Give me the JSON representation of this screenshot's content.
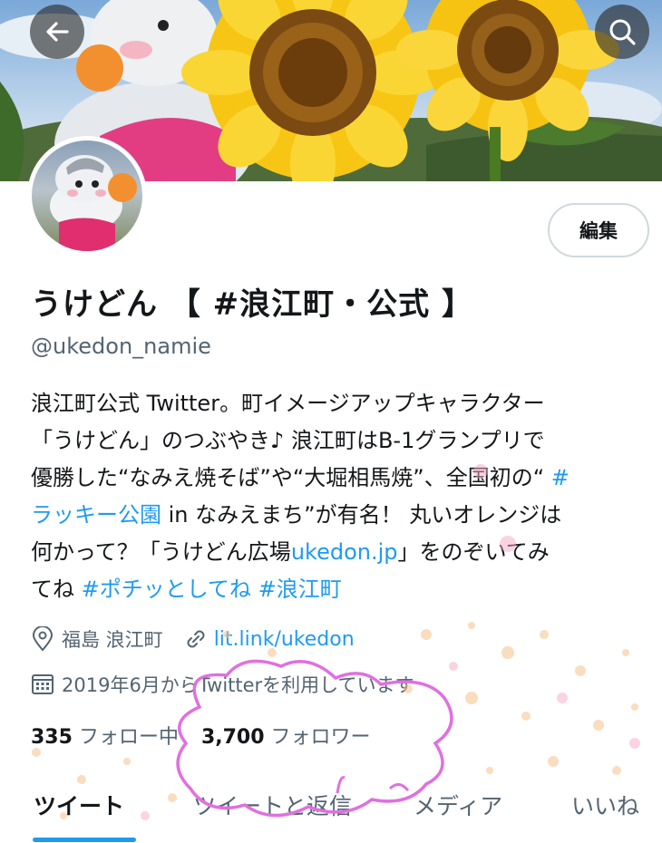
{
  "nav": {
    "back_icon": "arrow-left-icon",
    "search_icon": "search-icon"
  },
  "profile": {
    "display_name": "うけどん 【 #浪江町・公式 】",
    "handle": "@ukedon_namie",
    "edit_label": "編集",
    "bio_lines": [
      [
        {
          "t": "浪江町公式 Twitter。町イメージアップキャラクター",
          "link": false
        }
      ],
      [
        {
          "t": "「うけどん」のつぶやき♪ 浪江町はB-1グランプリで",
          "link": false
        }
      ],
      [
        {
          "t": "優勝した“なみえ焼そば”や“大堀相馬焼”、全国初の“ ",
          "link": false
        },
        {
          "t": "#",
          "link": true
        }
      ],
      [
        {
          "t": "ラッキー公園",
          "link": true
        },
        {
          "t": " in なみえまち”が有名！ 丸いオレンジは",
          "link": false
        }
      ],
      [
        {
          "t": "何かって？「うけどん広場",
          "link": false
        },
        {
          "t": "ukedon.jp",
          "link": true
        },
        {
          "t": "」をのぞいてみ",
          "link": false
        }
      ],
      [
        {
          "t": "てね ",
          "link": false
        },
        {
          "t": "#ポチッとしてね",
          "link": true
        },
        {
          "t": " ",
          "link": false
        },
        {
          "t": "#浪江町",
          "link": true
        }
      ]
    ],
    "location": "福島 浪江町",
    "website": "lit.link/ukedon",
    "joined": "2019年6月からTwitterを利用しています",
    "following_count": "335",
    "following_label": "フォロー中",
    "followers_count": "3,700",
    "followers_label": "フォロワー"
  },
  "tabs": [
    {
      "label": "ツイート",
      "active": true
    },
    {
      "label": "ツイートと返信",
      "active": false
    },
    {
      "label": "メディア",
      "active": false
    },
    {
      "label": "いいね",
      "active": false
    }
  ],
  "colors": {
    "accent": "#1d9bf0",
    "muted_text": "#536471",
    "doodle_pink": "#e070e0"
  }
}
